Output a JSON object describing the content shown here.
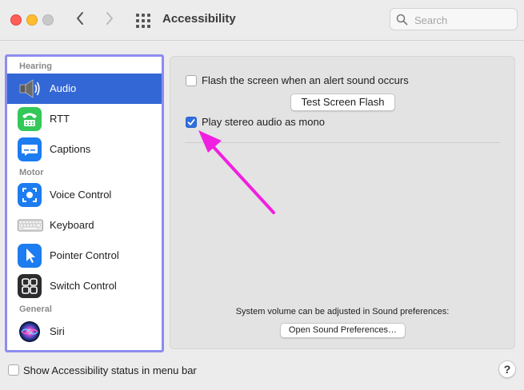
{
  "window": {
    "title": "Accessibility",
    "search_placeholder": "Search"
  },
  "sidebar": {
    "sections": {
      "hearing": "Hearing",
      "motor": "Motor",
      "general": "General"
    },
    "items": [
      {
        "label": "Audio",
        "icon": "speaker-icon",
        "selected": true
      },
      {
        "label": "RTT",
        "icon": "rtt-phone-icon"
      },
      {
        "label": "Captions",
        "icon": "captions-icon"
      },
      {
        "label": "Voice Control",
        "icon": "voice-control-icon"
      },
      {
        "label": "Keyboard",
        "icon": "keyboard-icon"
      },
      {
        "label": "Pointer Control",
        "icon": "pointer-icon"
      },
      {
        "label": "Switch Control",
        "icon": "switch-control-icon"
      },
      {
        "label": "Siri",
        "icon": "siri-icon"
      }
    ]
  },
  "audio": {
    "flash_label": "Flash the screen when an alert sound occurs",
    "flash_checked": false,
    "test_button": "Test Screen Flash",
    "mono_label": "Play stereo audio as mono",
    "mono_checked": true,
    "volume_hint": "System volume can be adjusted in Sound preferences:",
    "sound_prefs_button": "Open Sound Preferences…"
  },
  "footer": {
    "status_label": "Show Accessibility status in menu bar",
    "status_checked": false,
    "help": "?"
  },
  "colors": {
    "selection": "#3367d6",
    "checkbox_checked": "#2f6fe0",
    "annotation_arrow": "#f020e0",
    "sidebar_focus_ring": "#8c8cf0"
  }
}
